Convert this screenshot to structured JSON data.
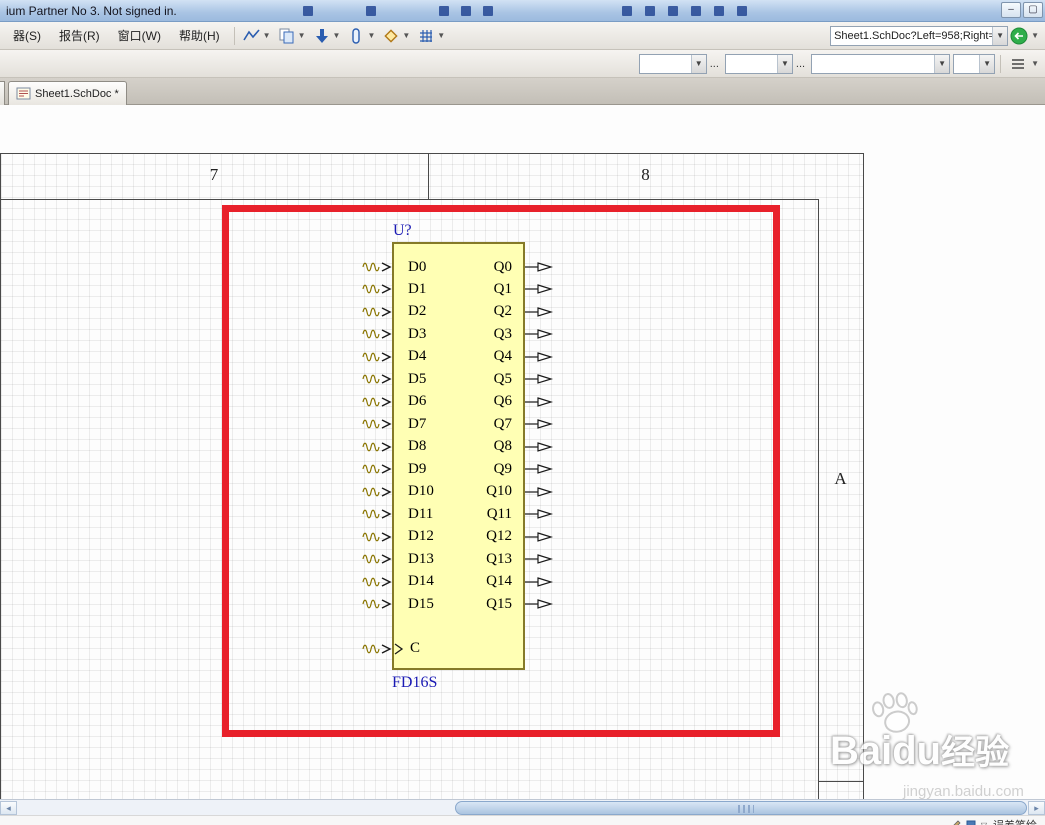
{
  "window": {
    "title": "ium Partner No 3. Not signed in."
  },
  "menu_bar": {
    "items": [
      "器(S)",
      "报告(R)",
      "窗口(W)",
      "帮助(H)"
    ]
  },
  "toolbar": {
    "icons": [
      "wire-icon",
      "sheet-symbol-icon",
      "arrow-down-icon",
      "pin-icon",
      "diamond-icon",
      "grid-icon"
    ],
    "doc_combo_value": "Sheet1.SchDoc?Left=958;Right=",
    "ellipsis": "..."
  },
  "toolbar2": {
    "combos": [
      "",
      "",
      "",
      ""
    ],
    "ellipsis": "..."
  },
  "tab_bar": {
    "tabs": [
      {
        "label": "Sheet1.SchDoc *"
      }
    ]
  },
  "sheet": {
    "zone_col_7": "7",
    "zone_col_8": "8",
    "zone_row_a": "A"
  },
  "component": {
    "designator": "U?",
    "part_name": "FD16S",
    "left_pins": [
      "D0",
      "D1",
      "D2",
      "D3",
      "D4",
      "D5",
      "D6",
      "D7",
      "D8",
      "D9",
      "D10",
      "D11",
      "D12",
      "D13",
      "D14",
      "D15"
    ],
    "right_pins": [
      "Q0",
      "Q1",
      "Q2",
      "Q3",
      "Q4",
      "Q5",
      "Q6",
      "Q7",
      "Q8",
      "Q9",
      "Q10",
      "Q11",
      "Q12",
      "Q13",
      "Q14",
      "Q15"
    ],
    "clock_pin": "C"
  },
  "watermark": {
    "brand": "Baidu",
    "brand_suffix": "经验",
    "url": "jingyan.baidu.com"
  },
  "status_bar": {
    "text": "误差笔绘"
  },
  "colors": {
    "component_fill": "#FFFFB4",
    "component_border": "#857A28",
    "highlight_red": "#E8212B",
    "schematic_blue": "#1A1AB4"
  }
}
